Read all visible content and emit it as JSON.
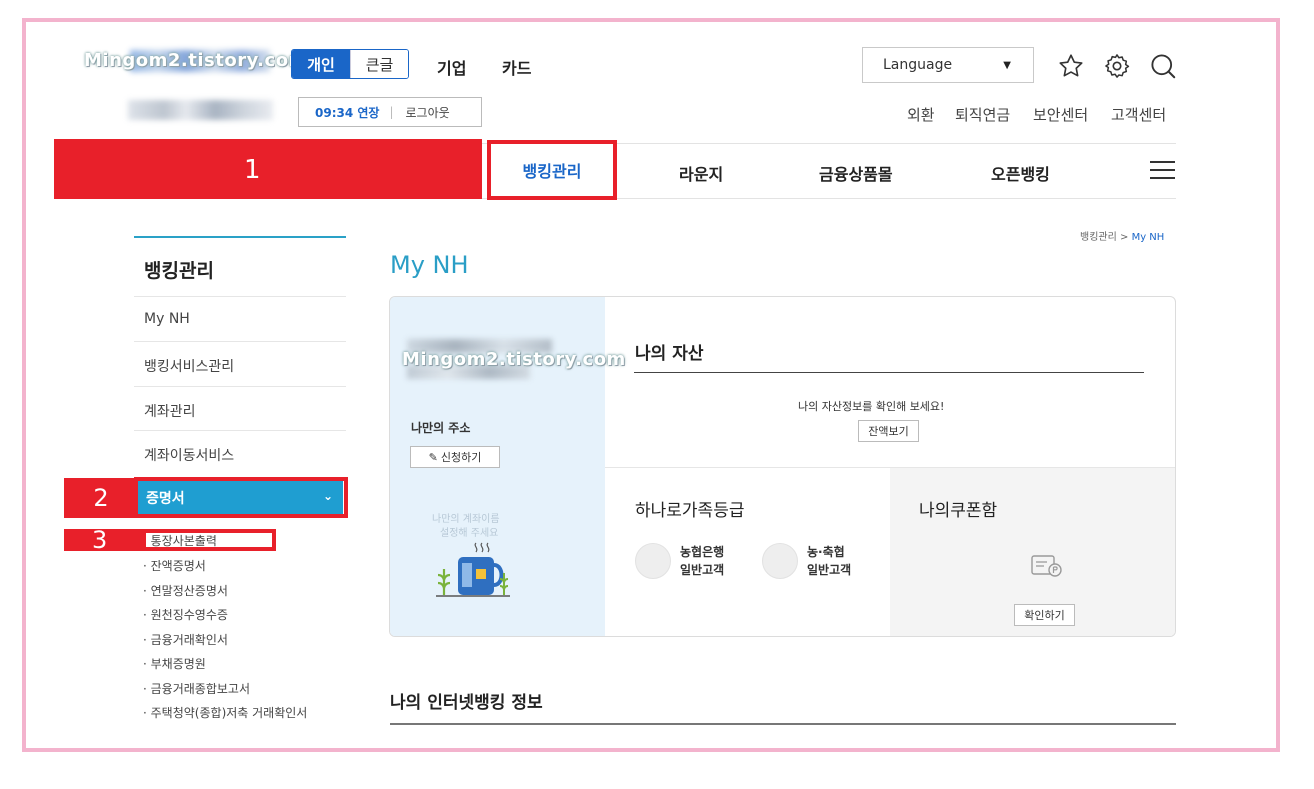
{
  "watermark": "Mingom2.tistory.com",
  "header": {
    "mode_tabs": [
      "개인",
      "큰글"
    ],
    "links": [
      "기업",
      "카드"
    ],
    "language": "Language",
    "session": {
      "timer": "09:34 연장",
      "logout": "로그아웃"
    },
    "util_links": [
      "외환",
      "퇴직연금",
      "보안센터",
      "고객센터"
    ]
  },
  "gnb": {
    "items": [
      "뱅킹관리",
      "라운지",
      "금융상품몰",
      "오픈뱅킹"
    ],
    "active": "뱅킹관리"
  },
  "annotations": [
    "1",
    "2",
    "3"
  ],
  "sidebar": {
    "title": "뱅킹관리",
    "items": [
      "My NH",
      "뱅킹서비스관리",
      "계좌관리",
      "계좌이동서비스"
    ],
    "active": "증명서",
    "sub_items": [
      "통장사본출력",
      "잔액증명서",
      "연말정산증명서",
      "원천징수영수증",
      "금융거래확인서",
      "부채증명원",
      "금융거래종합보고서",
      "주택청약(종합)저축 거래확인서"
    ]
  },
  "breadcrumb": {
    "parent": "뱅킹관리",
    "separator": ">",
    "current": "My NH"
  },
  "main": {
    "title": "My NH",
    "left_panel": {
      "address_label": "나만의 주소",
      "apply_button": "신청하기",
      "faded_text_1": "나만의 계좌이름",
      "faded_text_2": "설정해 주세요"
    },
    "assets": {
      "title": "나의 자산",
      "desc": "나의 자산정보를 확인해 보세요!",
      "button": "잔액보기"
    },
    "family_grade": {
      "title": "하나로가족등급",
      "grades": [
        {
          "org": "농협은행",
          "level": "일반고객"
        },
        {
          "org": "농·축협",
          "level": "일반고객"
        }
      ]
    },
    "coupon": {
      "title": "나의쿠폰함",
      "button": "확인하기"
    },
    "internet_banking_title": "나의 인터넷뱅킹 정보"
  }
}
